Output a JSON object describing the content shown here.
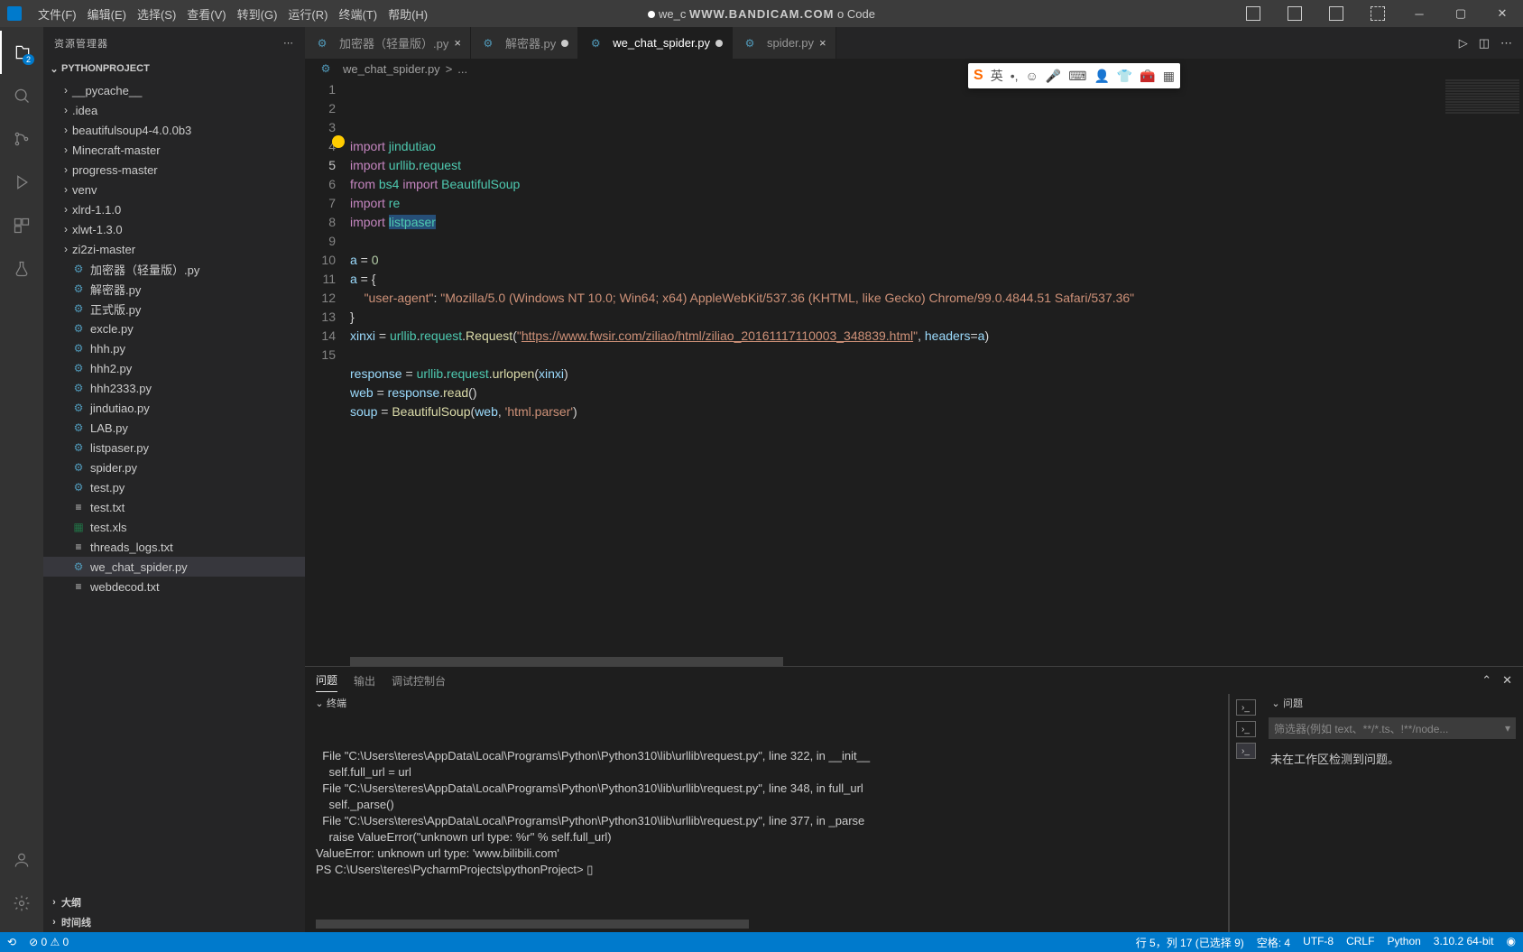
{
  "titlebar": {
    "menus": [
      "文件(F)",
      "编辑(E)",
      "选择(S)",
      "查看(V)",
      "转到(G)",
      "运行(R)",
      "终端(T)",
      "帮助(H)"
    ],
    "center_prefix": "we_c",
    "center_watermark": "WWW.BANDICAM.COM",
    "center_suffix": "o Code"
  },
  "activity": {
    "badge": "2"
  },
  "sidebar": {
    "title": "资源管理器",
    "project": "PYTHONPROJECT",
    "items": [
      {
        "type": "folder",
        "label": "__pycache__"
      },
      {
        "type": "folder",
        "label": ".idea"
      },
      {
        "type": "folder",
        "label": "beautifulsoup4-4.0.0b3"
      },
      {
        "type": "folder",
        "label": "Minecraft-master"
      },
      {
        "type": "folder",
        "label": "progress-master"
      },
      {
        "type": "folder",
        "label": "venv"
      },
      {
        "type": "folder",
        "label": "xlrd-1.1.0"
      },
      {
        "type": "folder",
        "label": "xlwt-1.3.0"
      },
      {
        "type": "folder",
        "label": "zi2zi-master"
      },
      {
        "type": "py",
        "label": "加密器（轻量版）.py"
      },
      {
        "type": "py",
        "label": "解密器.py"
      },
      {
        "type": "py",
        "label": "正式版.py"
      },
      {
        "type": "py",
        "label": "excle.py"
      },
      {
        "type": "py",
        "label": "hhh.py"
      },
      {
        "type": "py",
        "label": "hhh2.py"
      },
      {
        "type": "py",
        "label": "hhh2333.py"
      },
      {
        "type": "py",
        "label": "jindutiao.py"
      },
      {
        "type": "py",
        "label": "LAB.py"
      },
      {
        "type": "py",
        "label": "listpaser.py"
      },
      {
        "type": "py",
        "label": "spider.py"
      },
      {
        "type": "py",
        "label": "test.py"
      },
      {
        "type": "txt",
        "label": "test.txt"
      },
      {
        "type": "xls",
        "label": "test.xls"
      },
      {
        "type": "txt",
        "label": "threads_logs.txt"
      },
      {
        "type": "py",
        "label": "we_chat_spider.py",
        "active": true
      },
      {
        "type": "txt",
        "label": "webdecod.txt"
      }
    ],
    "outline": "大纲",
    "timeline": "时间线"
  },
  "tabs": [
    {
      "label": "加密器（轻量版）.py",
      "icon": "py"
    },
    {
      "label": "解密器.py",
      "icon": "py",
      "dirty": true
    },
    {
      "label": "we_chat_spider.py",
      "icon": "py",
      "dirty": true,
      "active": true
    },
    {
      "label": "spider.py",
      "icon": "py"
    }
  ],
  "breadcrumb": {
    "file": "we_chat_spider.py",
    "sep": ">",
    "more": "..."
  },
  "code": {
    "lines": [
      {
        "n": 1,
        "html": "<span class='kw'>import</span> <span class='mod'>jindutiao</span>"
      },
      {
        "n": 2,
        "html": "<span class='kw'>import</span> <span class='mod'>urllib</span>.<span class='mod'>request</span>"
      },
      {
        "n": 3,
        "html": "<span class='kw'>from</span> <span class='mod'>bs4</span> <span class='kw'>import</span> <span class='mod'>BeautifulSoup</span>"
      },
      {
        "n": 4,
        "html": "<span class='kw'>import</span> <span class='mod'>re</span>"
      },
      {
        "n": 5,
        "html": "<span class='kw'>import</span> <span class='sel mod'>listpaser</span>",
        "cur": true
      },
      {
        "n": 6,
        "html": ""
      },
      {
        "n": 7,
        "html": "<span class='var'>a</span> = <span class='num'>0</span>"
      },
      {
        "n": 8,
        "html": "<span class='var'>a</span> = {"
      },
      {
        "n": 9,
        "html": "    <span class='str'>\"user-agent\"</span>: <span class='str'>\"Mozilla/5.0 (Windows NT 10.0; Win64; x64) AppleWebKit/537.36 (KHTML, like Gecko) Chrome/99.0.4844.51 Safari/537.36\"</span>"
      },
      {
        "n": 10,
        "html": "}"
      },
      {
        "n": 11,
        "html": "<span class='var'>xinxi</span> = <span class='mod'>urllib</span>.<span class='mod'>request</span>.<span class='fn'>Request</span>(<span class='str'>\"</span><span class='url'>https://www.fwsir.com/ziliao/html/ziliao_20161117110003_348839.html</span><span class='str'>\"</span>, <span class='var'>headers</span>=<span class='var'>a</span>)"
      },
      {
        "n": 12,
        "html": ""
      },
      {
        "n": 13,
        "html": "<span class='var'>response</span> = <span class='mod'>urllib</span>.<span class='mod'>request</span>.<span class='fn'>urlopen</span>(<span class='var'>xinxi</span>)"
      },
      {
        "n": 14,
        "html": "<span class='var'>web</span> = <span class='var'>response</span>.<span class='fn'>read</span>()"
      },
      {
        "n": 15,
        "html": "<span class='var'>soup</span> = <span class='fn'>BeautifulSoup</span>(<span class='var'>web</span>, <span class='str'>'html.parser'</span>)"
      }
    ]
  },
  "ime": {
    "lang": "英"
  },
  "panel": {
    "tabs": [
      "问题",
      "输出",
      "调试控制台"
    ],
    "terminal_label": "终端",
    "problems_label": "问题",
    "filter_placeholder": "筛选器(例如 text、**/*.ts、!**/node...",
    "problems_msg": "未在工作区检测到问题。",
    "terminal_lines": [
      "  File \"C:\\Users\\teres\\AppData\\Local\\Programs\\Python\\Python310\\lib\\urllib\\request.py\", line 322, in __init__",
      "    self.full_url = url",
      "  File \"C:\\Users\\teres\\AppData\\Local\\Programs\\Python\\Python310\\lib\\urllib\\request.py\", line 348, in full_url",
      "    self._parse()",
      "  File \"C:\\Users\\teres\\AppData\\Local\\Programs\\Python\\Python310\\lib\\urllib\\request.py\", line 377, in _parse",
      "    raise ValueError(\"unknown url type: %r\" % self.full_url)",
      "ValueError: unknown url type: 'www.bilibili.com'",
      "PS C:\\Users\\teres\\PycharmProjects\\pythonProject> ▯"
    ]
  },
  "statusbar": {
    "left": [
      "⊘ 0  ⚠ 0"
    ],
    "right": [
      "行 5，列 17 (已选择 9)",
      "空格: 4",
      "UTF-8",
      "CRLF",
      "Python",
      "3.10.2 64-bit",
      "◉"
    ]
  }
}
